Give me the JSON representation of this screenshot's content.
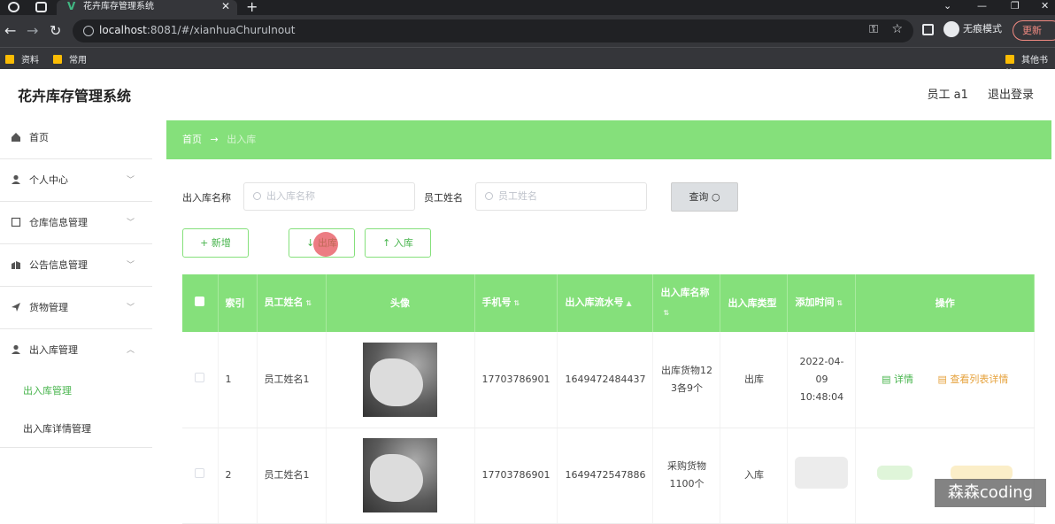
{
  "browser": {
    "tab_title": "花卉库存管理系统",
    "url_host": "localhost",
    "url_rest": ":8081/#/xianhuaChuruInout",
    "incognito_label": "无痕模式",
    "update_label": "更新",
    "bookmarks": [
      "资料",
      "常用",
      "其他书签"
    ]
  },
  "app": {
    "title": "花卉库存管理系统",
    "user_label": "员工 a1",
    "logout_label": "退出登录"
  },
  "sidebar": {
    "items": [
      {
        "label": "首页",
        "icon": "home-icon"
      },
      {
        "label": "个人中心",
        "icon": "user-icon"
      },
      {
        "label": "仓库信息管理",
        "icon": "warehouse-icon"
      },
      {
        "label": "公告信息管理",
        "icon": "notice-icon"
      },
      {
        "label": "货物管理",
        "icon": "send-icon"
      },
      {
        "label": "出入库管理",
        "icon": "user-icon"
      }
    ],
    "sub_items": [
      "出入库管理",
      "出入库详情管理"
    ]
  },
  "breadcrumb": {
    "home": "首页",
    "separator": "→",
    "current": "出入库"
  },
  "search": {
    "name_label": "出入库名称",
    "name_placeholder": "出入库名称",
    "staff_label": "员工姓名",
    "staff_placeholder": "员工姓名",
    "query_label": "查询"
  },
  "actions": {
    "add_label": "新增",
    "out_label": "出库",
    "in_label": "入库"
  },
  "table": {
    "columns": [
      "索引",
      "员工姓名",
      "头像",
      "手机号",
      "出入库流水号",
      "出入库名称",
      "出入库类型",
      "添加时间",
      "操作"
    ],
    "rows": [
      {
        "index": "1",
        "staff_name": "员工姓名1",
        "phone": "17703786901",
        "serial": "1649472484437",
        "name": "出库货物12 3各9个",
        "type": "出库",
        "time": "2022-04-09 10:48:04",
        "detail_label": "详情",
        "list_label": "查看列表详情"
      },
      {
        "index": "2",
        "staff_name": "员工姓名1",
        "phone": "17703786901",
        "serial": "1649472547886",
        "name": "采购货物1100个",
        "type": "入库",
        "time": "",
        "detail_label": "",
        "list_label": ""
      }
    ]
  },
  "watermark": "森森coding",
  "colors": {
    "primary_green": "#85e07b",
    "text_green": "#47b44c",
    "warning": "#e6a23c"
  }
}
